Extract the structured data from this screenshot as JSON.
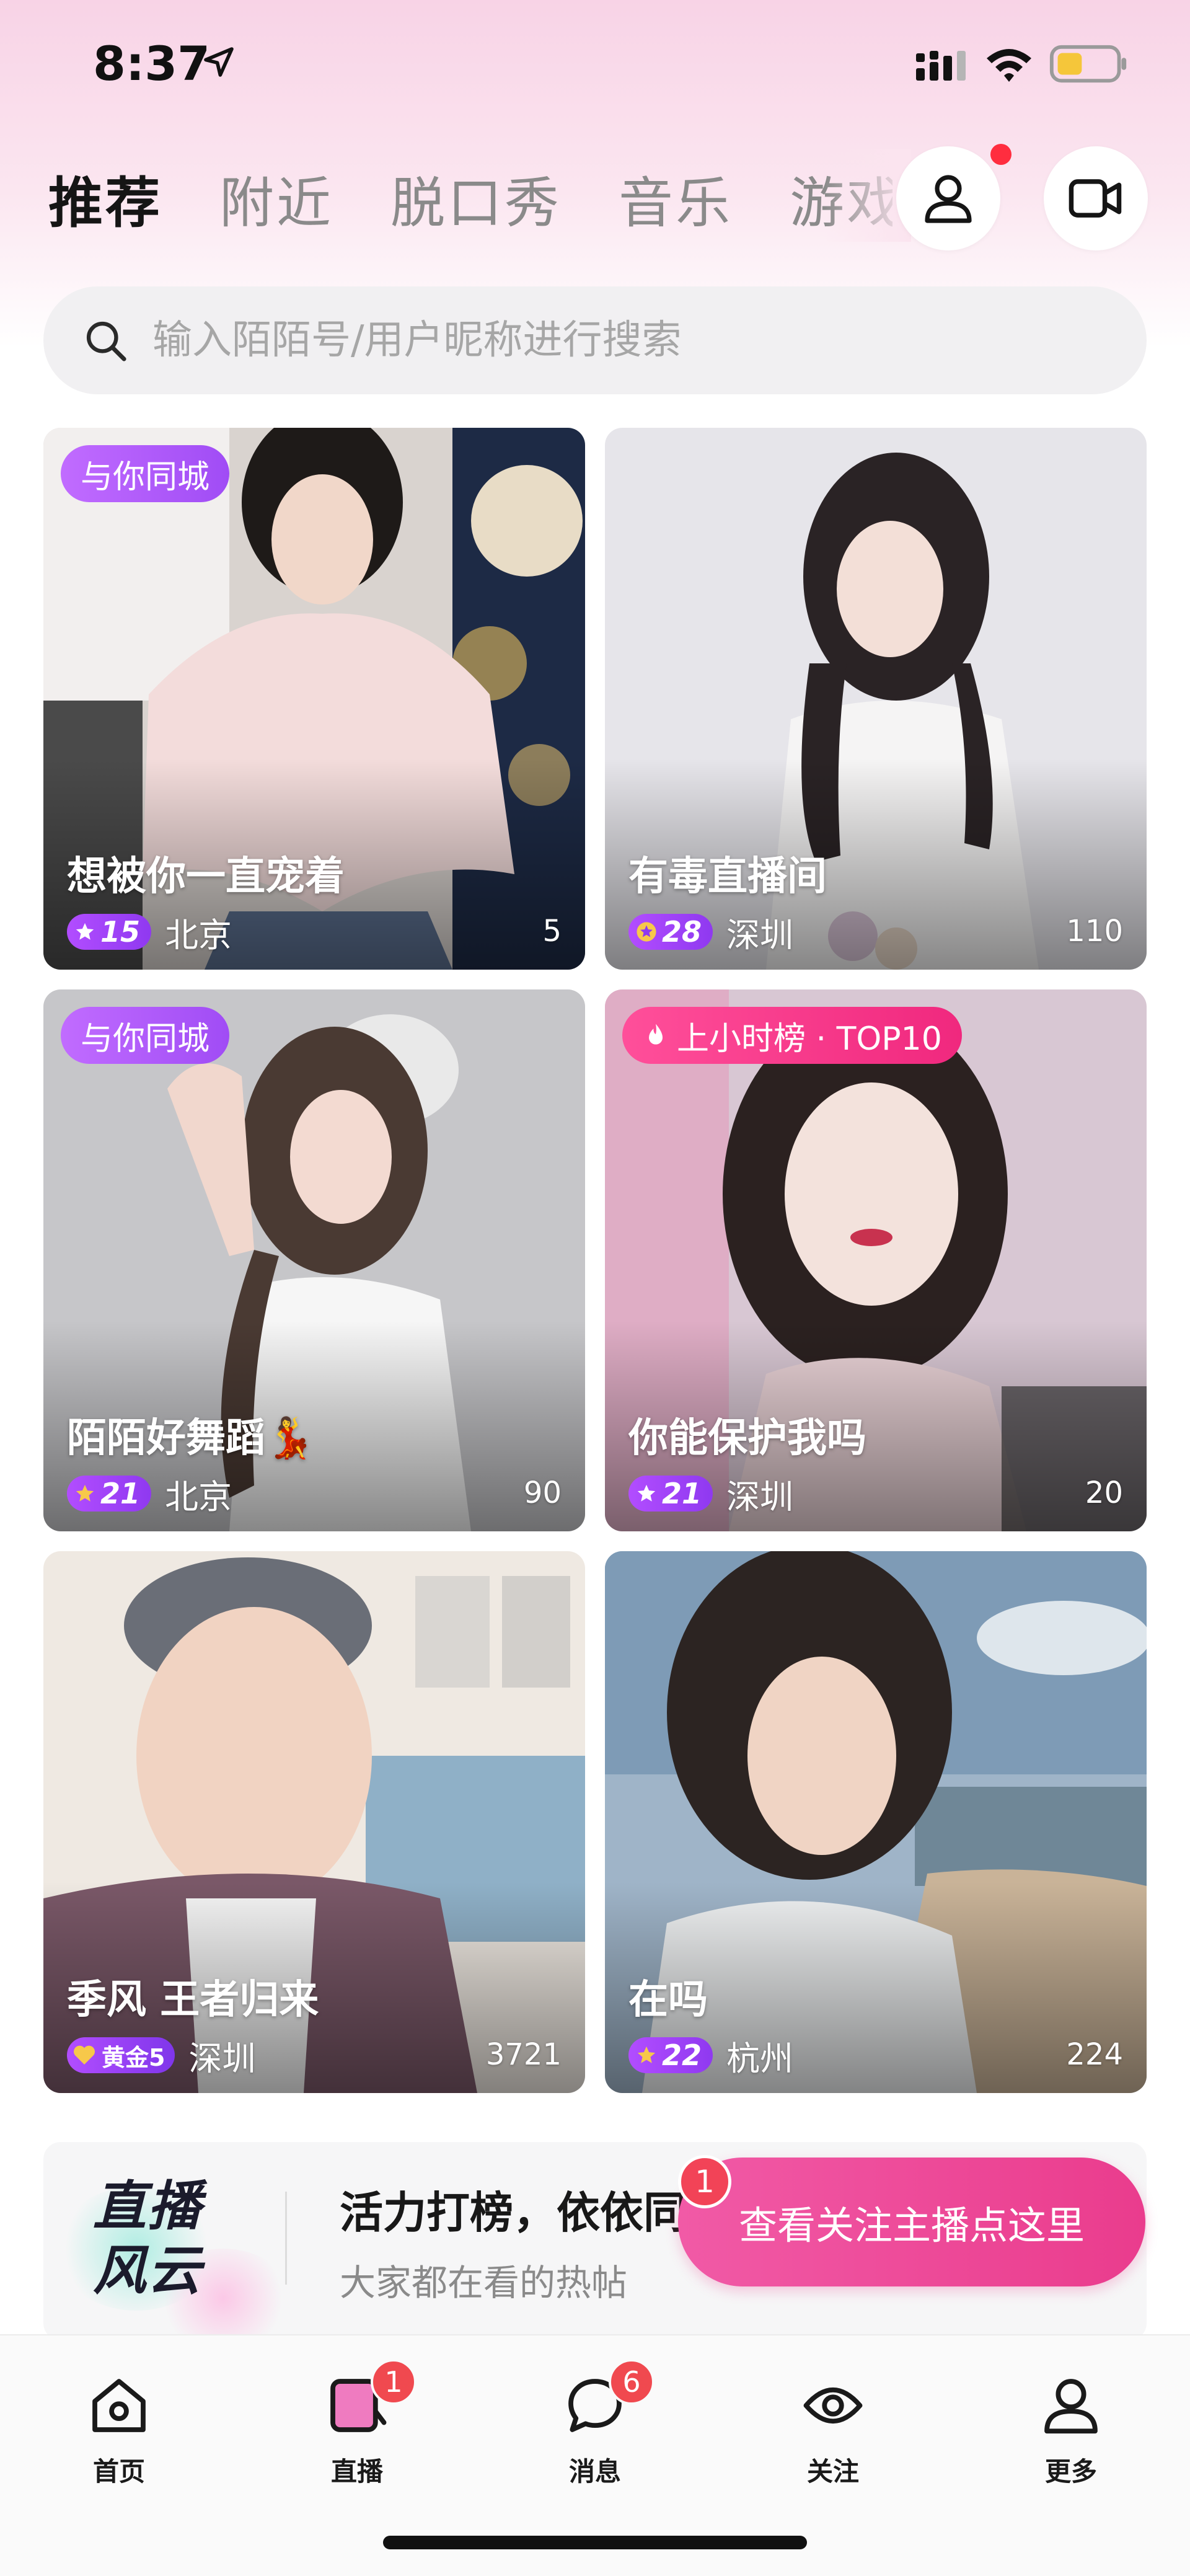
{
  "status_bar": {
    "time": "8:37",
    "icons": [
      "location-arrow-icon",
      "signal-icon",
      "wifi-icon",
      "battery-icon"
    ]
  },
  "tabs": [
    {
      "label": "推荐",
      "active": true
    },
    {
      "label": "附近",
      "active": false
    },
    {
      "label": "脱口秀",
      "active": false
    },
    {
      "label": "音乐",
      "active": false
    },
    {
      "label": "游戏",
      "active": false
    }
  ],
  "header_icons": [
    "profile-icon",
    "video-camera-icon"
  ],
  "search": {
    "placeholder": "输入陌陌号/用户昵称进行搜索"
  },
  "cards": [
    {
      "badge": "与你同城",
      "title": "想被你一直宠着",
      "level": "15",
      "city": "北京",
      "viewers": "5"
    },
    {
      "badge": "",
      "title": "有毒直播间",
      "level": "28",
      "city": "深圳",
      "viewers": "110"
    },
    {
      "badge": "与你同城",
      "title": "陌陌好舞蹈💃",
      "level": "21",
      "city": "北京",
      "viewers": "90"
    },
    {
      "badge": "上小时榜 · TOP10",
      "title": "你能保护我吗",
      "level": "21",
      "city": "深圳",
      "viewers": "20"
    },
    {
      "badge": "",
      "title": "季风 王者归来",
      "level": "黄金5",
      "city": "深圳",
      "viewers": "3721"
    },
    {
      "badge": "",
      "title": "在吗",
      "level": "22",
      "city": "杭州",
      "viewers": "224"
    }
  ],
  "banner": {
    "logo_line1": "直播",
    "logo_line2": "风云",
    "title": "活力打榜，依依同学",
    "subtitle": "大家都在看的热帖"
  },
  "follow_pill": {
    "label": "查看关注主播点这里",
    "count": "1"
  },
  "bottom_nav": [
    {
      "label": "首页",
      "icon": "home-icon",
      "badge": ""
    },
    {
      "label": "直播",
      "icon": "live-icon",
      "badge": "1"
    },
    {
      "label": "消息",
      "icon": "message-icon",
      "badge": "6"
    },
    {
      "label": "关注",
      "icon": "eye-icon",
      "badge": ""
    },
    {
      "label": "更多",
      "icon": "person-icon",
      "badge": ""
    }
  ],
  "colors": {
    "accent_pink": "#ea3c8d",
    "badge_purple": "#a04cf5",
    "badge_red": "#f0494f",
    "header_gradient": "#f8d3e6"
  }
}
